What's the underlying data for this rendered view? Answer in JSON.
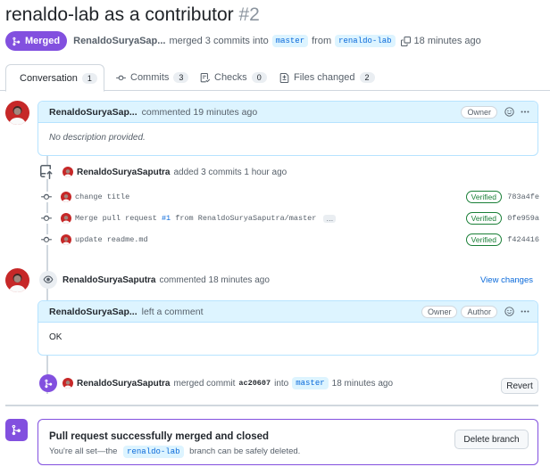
{
  "header": {
    "title": "renaldo-lab as a contributor",
    "number": "#2",
    "state": "Merged",
    "author": "RenaldoSuryaSap...",
    "merged_text": "merged 3 commits into",
    "base_branch": "master",
    "from_text": "from",
    "head_branch": "renaldo-lab",
    "time": "18 minutes ago"
  },
  "tabs": [
    {
      "label": "Conversation",
      "count": "1",
      "icon": "conversation-icon"
    },
    {
      "label": "Commits",
      "count": "3",
      "icon": "commit-icon"
    },
    {
      "label": "Checks",
      "count": "0",
      "icon": "checks-icon"
    },
    {
      "label": "Files changed",
      "count": "2",
      "icon": "file-diff-icon"
    }
  ],
  "first_comment": {
    "author": "RenaldoSuryaSap...",
    "action": "commented 19 minutes ago",
    "badge": "Owner",
    "body": "No description provided."
  },
  "commits_event": {
    "author": "RenaldoSuryaSaputra",
    "text": "added 3 commits 1 hour ago",
    "commits": [
      {
        "message": "change title",
        "verified": "Verified",
        "sha": "783a4fe"
      },
      {
        "message_prefix": "Merge pull request",
        "message_link": "#1",
        "message_suffix": "from RenaldoSuryaSaputra/master",
        "verified": "Verified",
        "sha": "0fe959a"
      },
      {
        "message": "update readme.md",
        "verified": "Verified",
        "sha": "f424416"
      }
    ]
  },
  "review_event": {
    "author": "RenaldoSuryaSaputra",
    "text": "commented 18 minutes ago",
    "view_changes": "View changes",
    "comment": {
      "author": "RenaldoSuryaSap...",
      "action": "left a comment",
      "badge_owner": "Owner",
      "badge_author": "Author",
      "body": "OK"
    }
  },
  "merge_event": {
    "author": "RenaldoSuryaSaputra",
    "text": "merged commit",
    "sha": "ac20607",
    "into_text": "into",
    "branch": "master",
    "time": "18 minutes ago",
    "revert": "Revert"
  },
  "merge_box": {
    "title": "Pull request successfully merged and closed",
    "sub_prefix": "You're all set—the",
    "branch": "renaldo-lab",
    "sub_suffix": "branch can be safely deleted.",
    "delete_button": "Delete branch"
  },
  "colors": {
    "merged": "#8250df",
    "link": "#0969da",
    "verified": "#1a7f37",
    "comment_header": "#ddf4ff"
  }
}
